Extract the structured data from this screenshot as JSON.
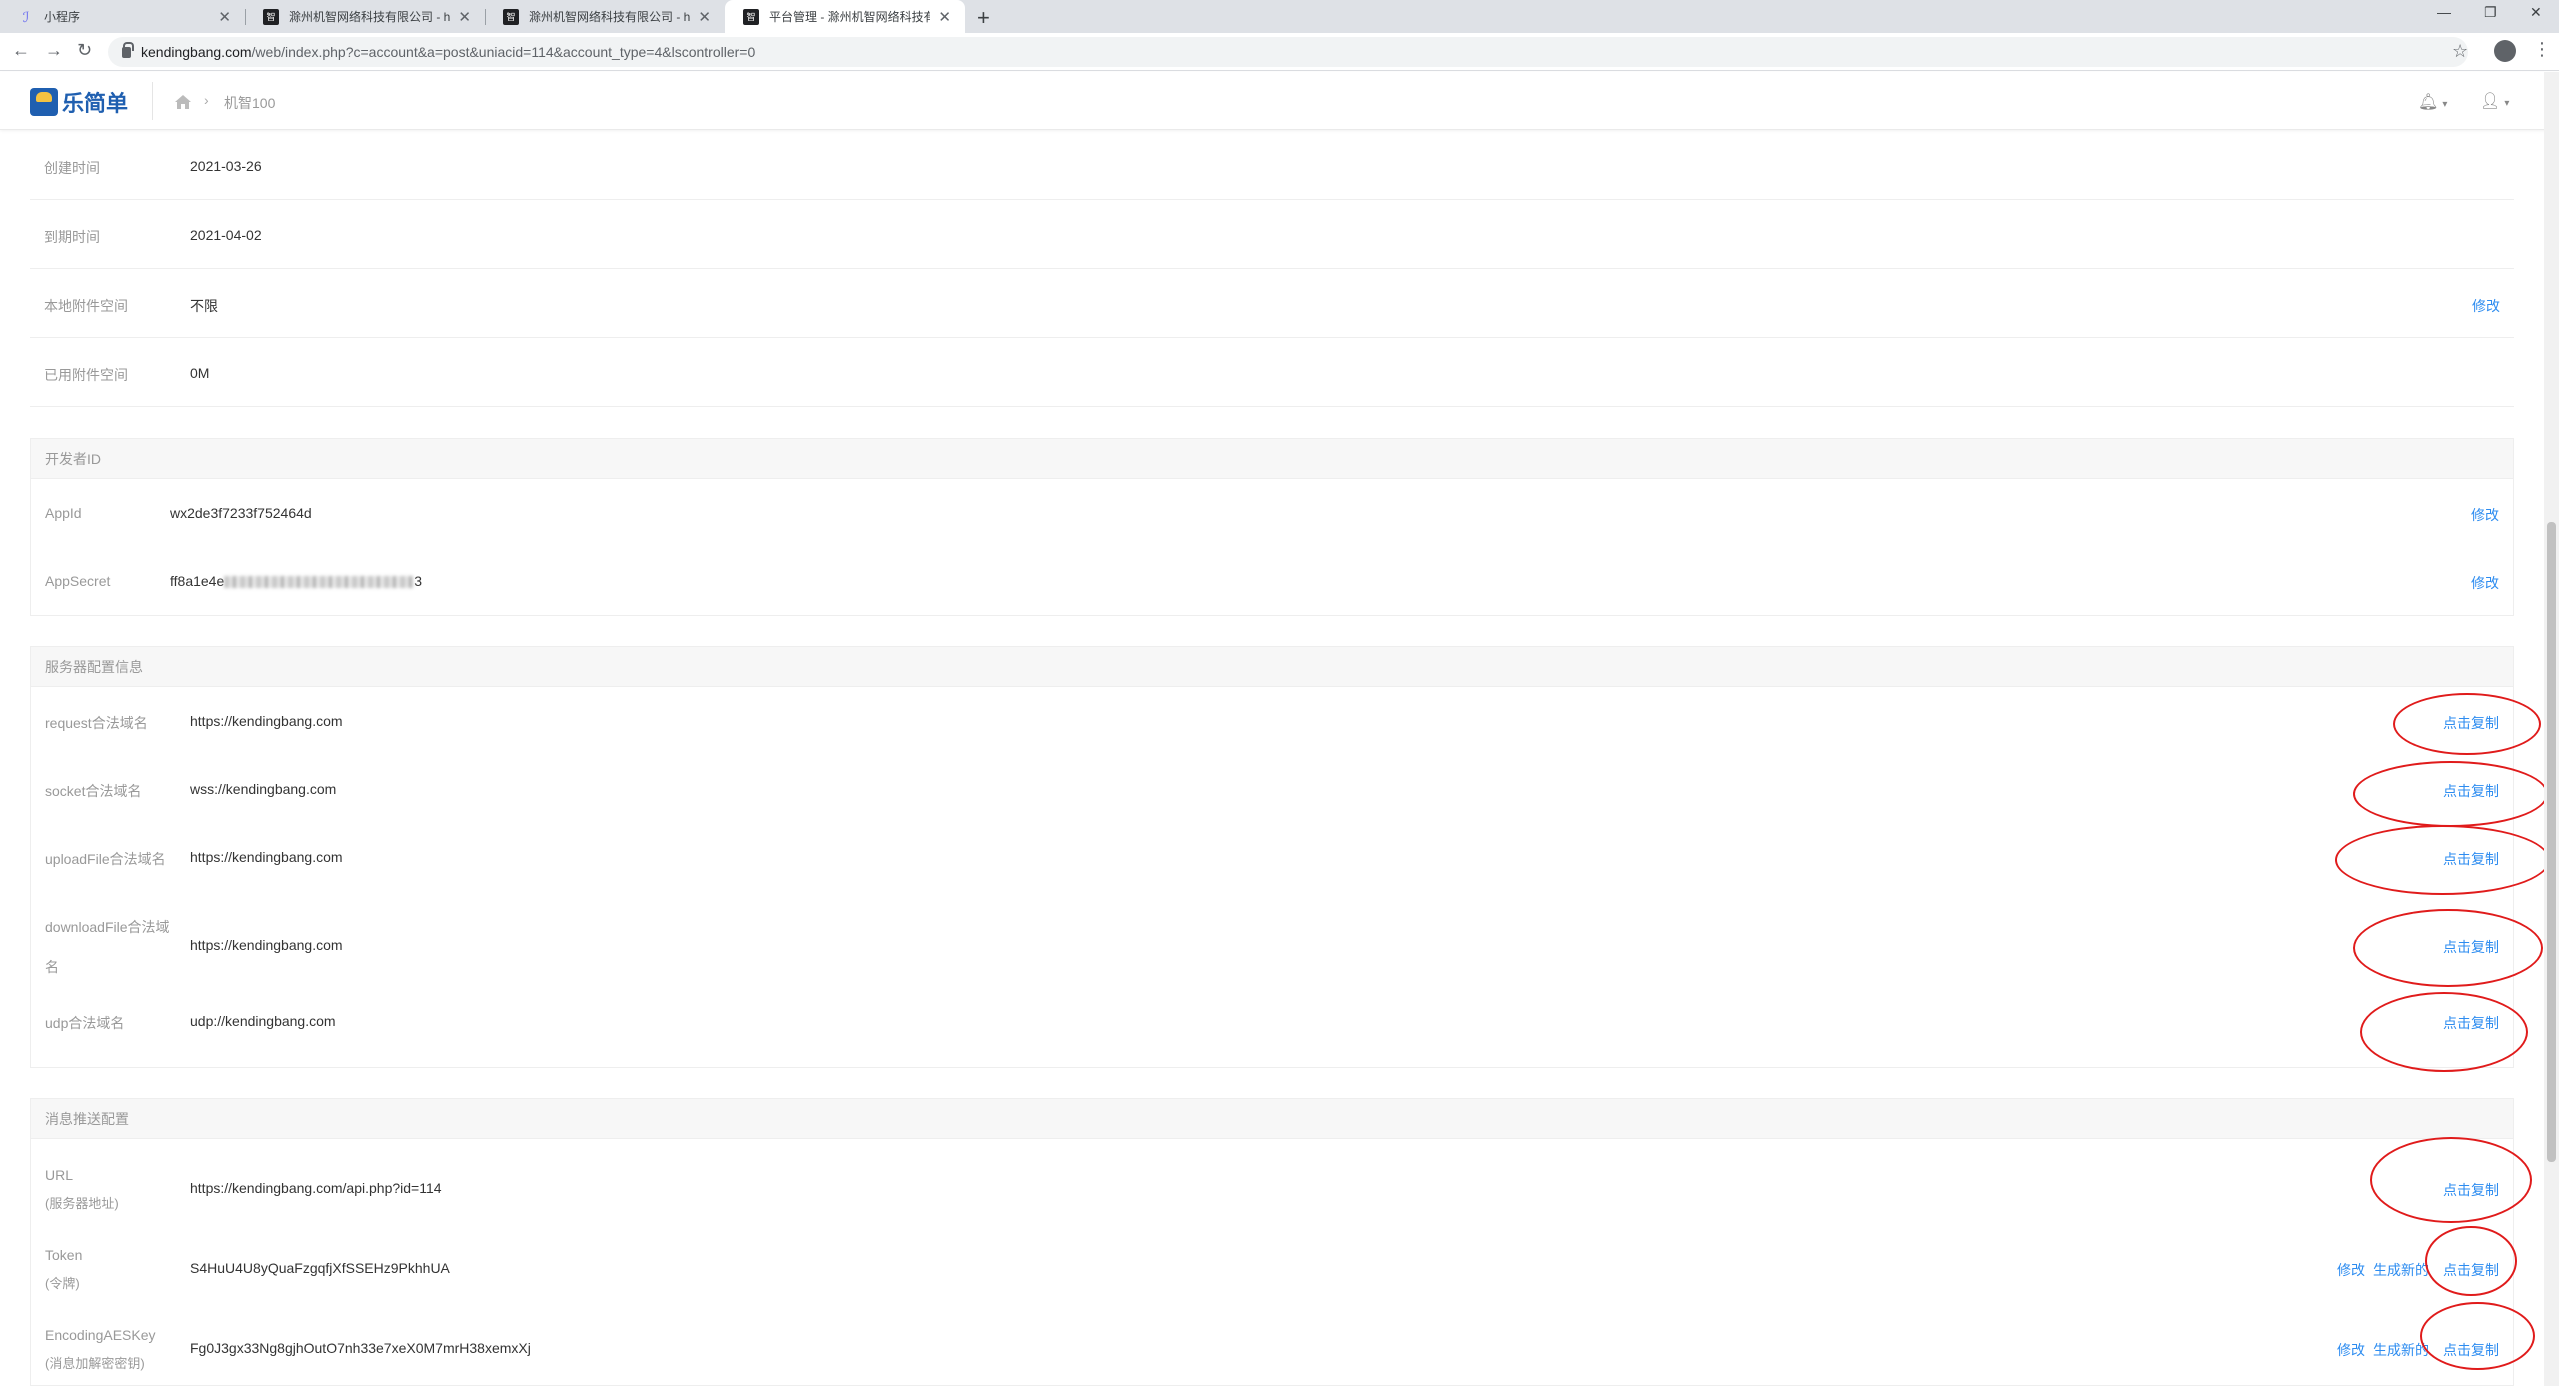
{
  "browser": {
    "tabs": [
      {
        "title": "小程序",
        "icon": "mini-program-icon"
      },
      {
        "title": "滁州机智网络科技有限公司 - htt",
        "icon": "site-logo-icon"
      },
      {
        "title": "滁州机智网络科技有限公司 - htt",
        "icon": "site-logo-icon"
      },
      {
        "title": "平台管理 - 滁州机智网络科技有限",
        "icon": "site-logo-icon",
        "active": true
      }
    ],
    "url_host": "kendingbang.com",
    "url_path": "/web/index.php?c=account&a=post&uniacid=114&account_type=4&lscontroller=0"
  },
  "header": {
    "brand": "乐简单",
    "breadcrumb": "机智100"
  },
  "basic": [
    {
      "label": "创建时间",
      "value": "2021-03-26",
      "action": ""
    },
    {
      "label": "到期时间",
      "value": "2021-04-02",
      "action": ""
    },
    {
      "label": "本地附件空间",
      "value": "不限",
      "action": "修改"
    },
    {
      "label": "已用附件空间",
      "value": "0M",
      "action": ""
    }
  ],
  "developer": {
    "title": "开发者ID",
    "appid_label": "AppId",
    "appid_value": "wx2de3f7233f752464d",
    "appid_action": "修改",
    "secret_label": "AppSecret",
    "secret_prefix": "ff8a1e4e",
    "secret_suffix": "3",
    "secret_action": "修改"
  },
  "server": {
    "title": "服务器配置信息",
    "rows": [
      {
        "label": "request合法域名",
        "value": "https://kendingbang.com",
        "action": "点击复制"
      },
      {
        "label": "socket合法域名",
        "value": "wss://kendingbang.com",
        "action": "点击复制"
      },
      {
        "label": "uploadFile合法域名",
        "value": "https://kendingbang.com",
        "action": "点击复制"
      },
      {
        "label": "downloadFile合法域",
        "label2": "名",
        "value": "https://kendingbang.com",
        "action": "点击复制"
      },
      {
        "label": "udp合法域名",
        "value": "udp://kendingbang.com",
        "action": "点击复制"
      }
    ]
  },
  "message": {
    "title": "消息推送配置",
    "rows": [
      {
        "label": "URL",
        "sub": "(服务器地址)",
        "value": "https://kendingbang.com/api.php?id=114",
        "copy": "点击复制"
      },
      {
        "label": "Token",
        "sub": "(令牌)",
        "value": "S4HuU4U8yQuaFzgqfjXfSSEHz9PkhhUA",
        "edit": "修改",
        "gen": "生成新的",
        "copy": "点击复制"
      },
      {
        "label": "EncodingAESKey",
        "sub": "(消息加解密密钥)",
        "value": "Fg0J3gx33Ng8gjhOutO7nh33e7xeX0M7mrH38xemxXj",
        "edit": "修改",
        "gen": "生成新的",
        "copy": "点击复制"
      }
    ]
  },
  "colors": {
    "link": "#2d8cf0",
    "annotation": "#e01b1b"
  }
}
